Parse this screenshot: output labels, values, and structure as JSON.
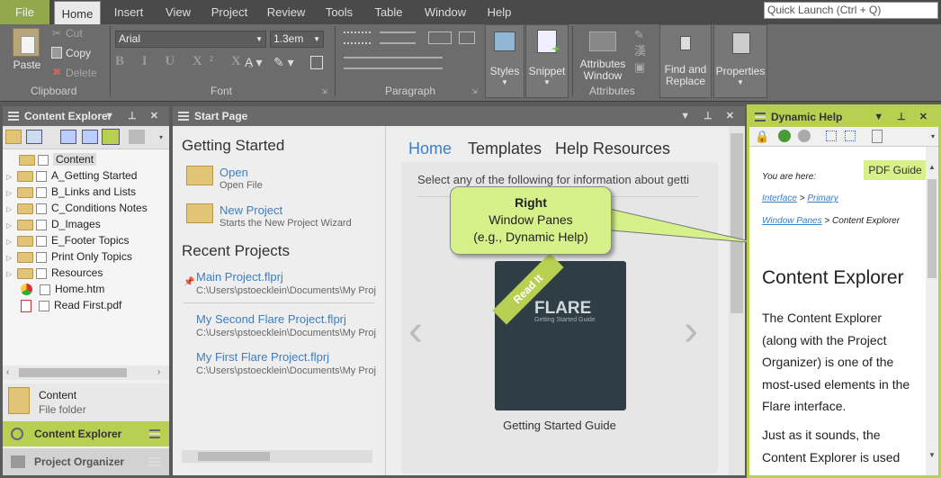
{
  "menu": {
    "file": "File",
    "items": [
      "Home",
      "Insert",
      "View",
      "Project",
      "Review",
      "Tools",
      "Table",
      "Window",
      "Help"
    ],
    "quick_launch": "Quick Launch (Ctrl + Q)"
  },
  "ribbon": {
    "clipboard": {
      "paste": "Paste",
      "cut": "Cut",
      "copy": "Copy",
      "delete": "Delete",
      "label": "Clipboard"
    },
    "font": {
      "family": "Arial",
      "size": "1.3em",
      "label": "Font"
    },
    "paragraph": {
      "label": "Paragraph"
    },
    "styles": "Styles",
    "snippet": "Snippet",
    "attributes_window": "Attributes Window",
    "attributes_label": "Attributes",
    "find_replace": "Find and Replace",
    "properties": "Properties"
  },
  "content_explorer": {
    "title": "Content Explorer",
    "root": "Content",
    "items": [
      {
        "label": "A_Getting Started",
        "type": "folder"
      },
      {
        "label": "B_Links and Lists",
        "type": "folder"
      },
      {
        "label": "C_Conditions Notes",
        "type": "folder"
      },
      {
        "label": "D_Images",
        "type": "folder"
      },
      {
        "label": "E_Footer Topics",
        "type": "folder"
      },
      {
        "label": "Print Only Topics",
        "type": "folder"
      },
      {
        "label": "Resources",
        "type": "folder"
      },
      {
        "label": "Home.htm",
        "type": "htm"
      },
      {
        "label": "Read First.pdf",
        "type": "pdf"
      }
    ],
    "info_name": "Content",
    "info_type": "File folder",
    "tab_content_explorer": "Content Explorer",
    "tab_project_organizer": "Project Organizer"
  },
  "start_page": {
    "title": "Start Page",
    "getting_started": "Getting Started",
    "open": "Open",
    "open_desc": "Open File",
    "new_project": "New Project",
    "new_project_desc": "Starts the New Project Wizard",
    "recent_projects": "Recent Projects",
    "recent": [
      {
        "name": "Main Project.flprj",
        "path": "C:\\Users\\pstoecklein\\Documents\\My Proj"
      },
      {
        "name": "My Second Flare Project.flprj",
        "path": "C:\\Users\\pstoecklein\\Documents\\My Proj"
      },
      {
        "name": "My First Flare Project.flprj",
        "path": "C:\\Users\\pstoecklein\\Documents\\My Proj"
      }
    ],
    "tabs": [
      "Home",
      "Templates",
      "Help Resources"
    ],
    "select_text": "Select any of the following for information about getti",
    "book_caption": "Getting Started Guide",
    "book_ribbon": "Read It",
    "book_title": "FLARE",
    "book_subtitle": "Getting Started Guide"
  },
  "callout": {
    "title": "Right",
    "line1": "Window Panes",
    "line2": "(e.g., Dynamic Help)"
  },
  "dynamic_help": {
    "title": "Dynamic Help",
    "pdf_guide": "PDF Guide",
    "you_are_here": "You are here:",
    "crumb1": "Interface",
    "crumb_sep": ">",
    "crumb2": "Primary",
    "crumb3": "Window Panes",
    "crumb4": "Content Explorer",
    "heading": "Content Explorer",
    "para1": "The Content Explorer (along with the Project Organizer) is one of the most-used elements in the Flare interface.",
    "para2": "Just as it sounds, the Content Explorer is used"
  },
  "colors": {
    "accent_green": "#b9cf52",
    "link_blue": "#3b7fc4",
    "callout_fill": "#d6f08a"
  }
}
